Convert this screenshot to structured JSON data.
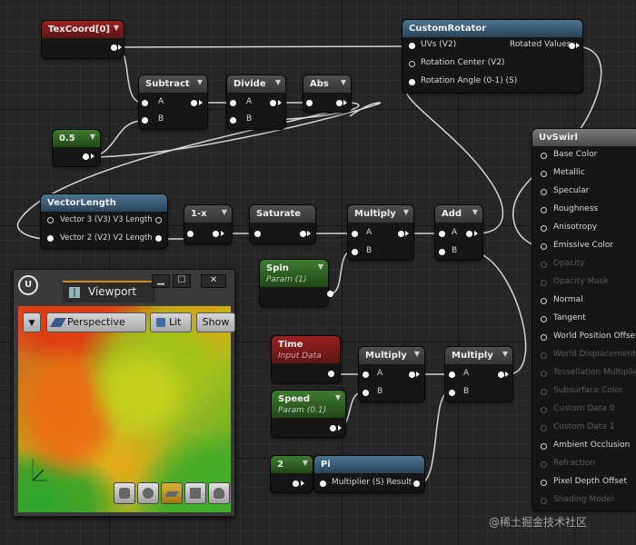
{
  "nodes": {
    "texcoord": {
      "title": "TexCoord[0]"
    },
    "subtract": {
      "title": "Subtract",
      "a": "A",
      "b": "B"
    },
    "divide": {
      "title": "Divide",
      "a": "A",
      "b": "B"
    },
    "abs": {
      "title": "Abs"
    },
    "const_half": {
      "title": "0.5"
    },
    "custom_rotator": {
      "title": "CustomRotator",
      "in_uvs": "UVs (V2)",
      "in_center": "Rotation Center (V2)",
      "in_angle": "Rotation Angle (0-1) (S)",
      "out": "Rotated Values"
    },
    "vector_length": {
      "title": "VectorLength",
      "in1": "Vector 3 (V3) V3 Length",
      "in2": "Vector 2 (V2) V2 Length"
    },
    "one_minus": {
      "title": "1-x"
    },
    "saturate": {
      "title": "Saturate"
    },
    "multiply1": {
      "title": "Multiply",
      "a": "A",
      "b": "B"
    },
    "add": {
      "title": "Add",
      "a": "A",
      "b": "B"
    },
    "spin": {
      "title": "Spin",
      "sub": "Param (1)"
    },
    "time": {
      "title": "Time",
      "sub": "Input Data"
    },
    "multiply2": {
      "title": "Multiply",
      "a": "A",
      "b": "B"
    },
    "multiply3": {
      "title": "Multiply",
      "a": "A",
      "b": "B"
    },
    "speed": {
      "title": "Speed",
      "sub": "Param (0.1)"
    },
    "const_two": {
      "title": "2"
    },
    "pi": {
      "title": "Pi",
      "in": "Multiplier (S) Result"
    }
  },
  "material": {
    "title": "UvSwirl",
    "pins": [
      {
        "label": "Base Color",
        "enabled": true
      },
      {
        "label": "Metallic",
        "enabled": true
      },
      {
        "label": "Specular",
        "enabled": true
      },
      {
        "label": "Roughness",
        "enabled": true
      },
      {
        "label": "Anisotropy",
        "enabled": true
      },
      {
        "label": "Emissive Color",
        "enabled": true
      },
      {
        "label": "Opacity",
        "enabled": false
      },
      {
        "label": "Opacity Mask",
        "enabled": false
      },
      {
        "label": "Normal",
        "enabled": true
      },
      {
        "label": "Tangent",
        "enabled": true
      },
      {
        "label": "World Position Offset",
        "enabled": true
      },
      {
        "label": "World Displacement",
        "enabled": false
      },
      {
        "label": "Tessellation Multiplier",
        "enabled": false
      },
      {
        "label": "Subsurface Color",
        "enabled": false
      },
      {
        "label": "Custom Data 0",
        "enabled": false
      },
      {
        "label": "Custom Data 1",
        "enabled": false
      },
      {
        "label": "Ambient Occlusion",
        "enabled": true
      },
      {
        "label": "Refraction",
        "enabled": false
      },
      {
        "label": "Pixel Depth Offset",
        "enabled": true
      },
      {
        "label": "Shading Model",
        "enabled": false
      }
    ]
  },
  "viewport": {
    "logo": "U",
    "tab_label": "Viewport",
    "minimize": "▁",
    "maximize": "☐",
    "close": "✕",
    "perspective_label": "Perspective",
    "lit_label": "Lit",
    "show_label": "Show",
    "preview_shapes": [
      "cylinder-icon",
      "sphere-icon",
      "plane-icon",
      "cube-icon",
      "teapot-icon"
    ]
  },
  "watermark": "@稀土掘金技术社区",
  "colors": {
    "wire": "#d4d4d4",
    "accent": "#d18b1d"
  }
}
